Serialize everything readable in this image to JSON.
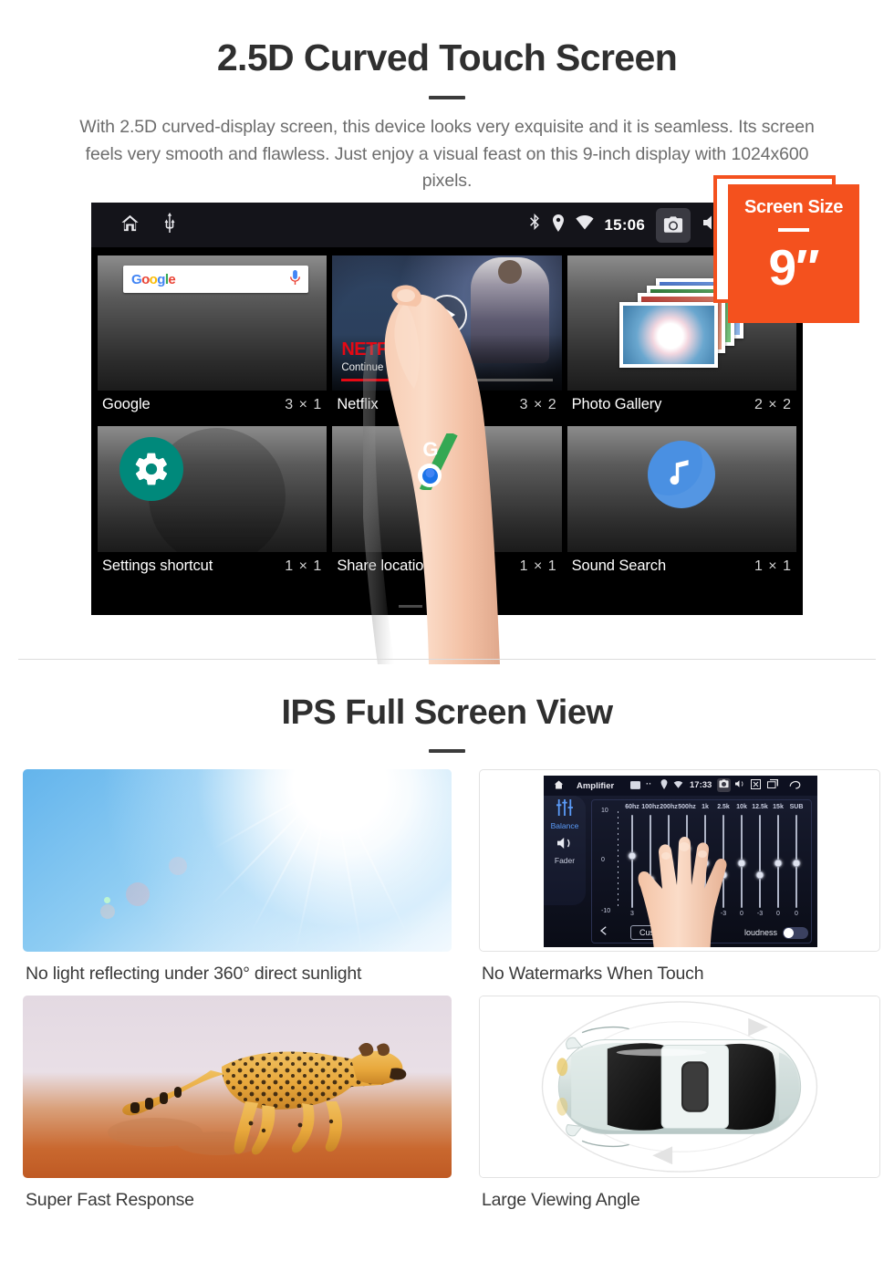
{
  "section1": {
    "title": "2.5D Curved Touch Screen",
    "lead": "With 2.5D curved-display screen, this device looks very exquisite and it is seamless. Its screen feels very smooth and flawless. Just enjoy a visual feast on this 9-inch display with 1024x600 pixels.",
    "badge": {
      "title": "Screen Size",
      "value": "9″"
    },
    "device": {
      "statusbar": {
        "time": "15:06",
        "left_icons": [
          "home-icon",
          "usb-icon"
        ],
        "right_icons": [
          "bluetooth-icon",
          "location-icon",
          "wifi-icon",
          "camera-icon",
          "volume-icon",
          "close-icon",
          "recents-icon"
        ]
      },
      "widgets": [
        {
          "name": "Google",
          "size": "3 × 1",
          "logo": "Google",
          "mic": "mic-icon"
        },
        {
          "name": "Netflix",
          "size": "3 × 2",
          "wordmark": "NETFLIX",
          "subtitle": "Continue Marvel's Daredevil"
        },
        {
          "name": "Photo Gallery",
          "size": "2 × 2"
        },
        {
          "name": "Settings shortcut",
          "size": "1 × 1"
        },
        {
          "name": "Share location",
          "size": "1 × 1",
          "maps_letter": "G"
        },
        {
          "name": "Sound Search",
          "size": "1 × 1"
        }
      ],
      "page_indicator": {
        "count": 3,
        "active": 3
      }
    }
  },
  "section2": {
    "title": "IPS Full Screen View",
    "cards": [
      {
        "caption": "No light reflecting under 360° direct sunlight",
        "art": "sunlight"
      },
      {
        "caption": "No Watermarks When Touch",
        "art": "amplifier"
      },
      {
        "caption": "Super Fast Response",
        "art": "cheetah"
      },
      {
        "caption": "Large Viewing Angle",
        "art": "car-top-view"
      }
    ],
    "amplifier": {
      "title": "Amplifier",
      "time": "17:33",
      "side_items": [
        "Balance",
        "Fader"
      ],
      "bands": [
        "60hz",
        "100hz",
        "200hz",
        "500hz",
        "1k",
        "2.5k",
        "10k",
        "12.5k",
        "15k",
        "SUB"
      ],
      "values": [
        "3",
        "-4",
        "0",
        "0",
        "0",
        "-3",
        "0",
        "-3",
        "0",
        "0"
      ],
      "scale": {
        "top": "10",
        "mid": "0",
        "bottom": "-10"
      },
      "preset_button": "Custom",
      "loudness_label": "loudness"
    }
  },
  "colors": {
    "accent": "#F4511E",
    "heading": "#2f2f2f",
    "body_text": "#6d6d6d",
    "netflix_red": "#E50914",
    "settings_teal": "#00897B",
    "sound_blue": "#4A90E2"
  }
}
